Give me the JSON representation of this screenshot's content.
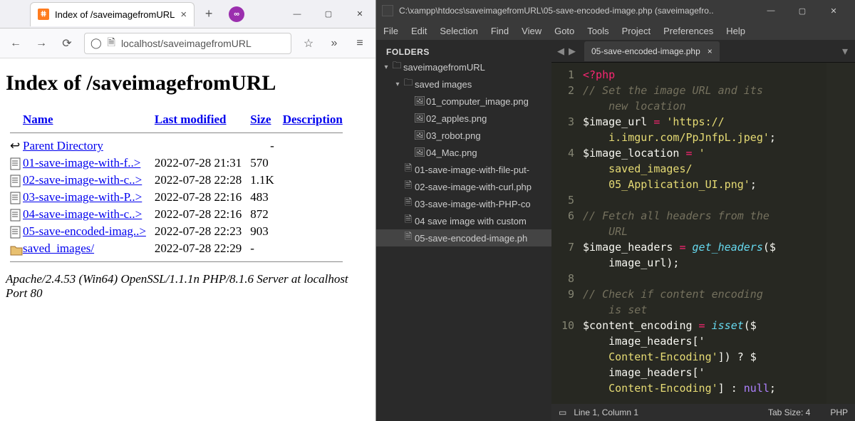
{
  "browser": {
    "tab_title": "Index of /saveimagefromURL",
    "url": "localhost/saveimagefromURL",
    "page_heading": "Index of /saveimagefromURL",
    "columns": {
      "name": "Name",
      "modified": "Last modified",
      "size": "Size",
      "desc": "Description"
    },
    "parent": "Parent Directory",
    "rows": [
      {
        "name": "01-save-image-with-f..>",
        "modified": "2022-07-28 21:31",
        "size": "570",
        "type": "file"
      },
      {
        "name": "02-save-image-with-c..>",
        "modified": "2022-07-28 22:28",
        "size": "1.1K",
        "type": "file"
      },
      {
        "name": "03-save-image-with-P..>",
        "modified": "2022-07-28 22:16",
        "size": "483",
        "type": "file"
      },
      {
        "name": "04-save-image-with-c..>",
        "modified": "2022-07-28 22:16",
        "size": "872",
        "type": "file"
      },
      {
        "name": "05-save-encoded-imag..>",
        "modified": "2022-07-28 22:23",
        "size": "903",
        "type": "file"
      },
      {
        "name": "saved_images/",
        "modified": "2022-07-28 22:29",
        "size": "-",
        "type": "dir"
      }
    ],
    "footer": "Apache/2.4.53 (Win64) OpenSSL/1.1.1n PHP/8.1.6 Server at localhost Port 80"
  },
  "editor": {
    "title": "C:\\xampp\\htdocs\\saveimagefromURL\\05-save-encoded-image.php (saveimagefro..",
    "menu": [
      "File",
      "Edit",
      "Selection",
      "Find",
      "View",
      "Goto",
      "Tools",
      "Project",
      "Preferences",
      "Help"
    ],
    "sidebar_title": "FOLDERS",
    "tree": {
      "root": "saveimagefromURL",
      "folder": "saved images",
      "images": [
        "01_computer_image.png",
        "02_apples.png",
        "03_robot.png",
        "04_Mac.png"
      ],
      "files": [
        "01-save-image-with-file-put-",
        "02-save-image-with-curl.php",
        "03-save-image-with-PHP-co",
        "04 save image with custom",
        "05-save-encoded-image.ph"
      ]
    },
    "open_tab": "05-save-encoded-image.php",
    "gutter": [
      "1",
      "2",
      "",
      "3",
      "",
      "4",
      "",
      "",
      "5",
      "6",
      "",
      "7",
      "",
      "8",
      "9",
      "",
      "10",
      "",
      "",
      "",
      ""
    ],
    "code_lines": [
      [
        "php_open",
        "<?php"
      ],
      [
        "comment",
        "// Set the image URL and its"
      ],
      [
        "comment",
        "    new location"
      ],
      [
        "assign",
        "$image_url",
        " = ",
        "'https://",
        ""
      ],
      [
        "cont_str",
        "    i.imgur.com/PpJnfpL.jpeg'",
        ";"
      ],
      [
        "assign",
        "$image_location",
        " = ",
        "'",
        ""
      ],
      [
        "cont_str",
        "    saved_images/",
        ""
      ],
      [
        "cont_str",
        "    05_Application_UI.png'",
        ";"
      ],
      [
        "blank",
        ""
      ],
      [
        "comment",
        "// Fetch all headers from the"
      ],
      [
        "comment",
        "    URL"
      ],
      [
        "call",
        "$image_headers",
        " = ",
        "get_headers",
        "($"
      ],
      [
        "cont",
        "    image_url);"
      ],
      [
        "blank",
        ""
      ],
      [
        "comment",
        "// Check if content encoding"
      ],
      [
        "comment",
        "    is set"
      ],
      [
        "call",
        "$content_encoding",
        " = ",
        "isset",
        "($"
      ],
      [
        "cont",
        "    image_headers['"
      ],
      [
        "cont_str2",
        "    Content-Encoding'",
        "]) ? $"
      ],
      [
        "cont",
        "    image_headers['"
      ],
      [
        "cont_str3",
        "    Content-Encoding'",
        "] : ",
        "null",
        ";"
      ]
    ],
    "status": {
      "pos": "Line 1, Column 1",
      "tabsize": "Tab Size: 4",
      "lang": "PHP"
    }
  }
}
